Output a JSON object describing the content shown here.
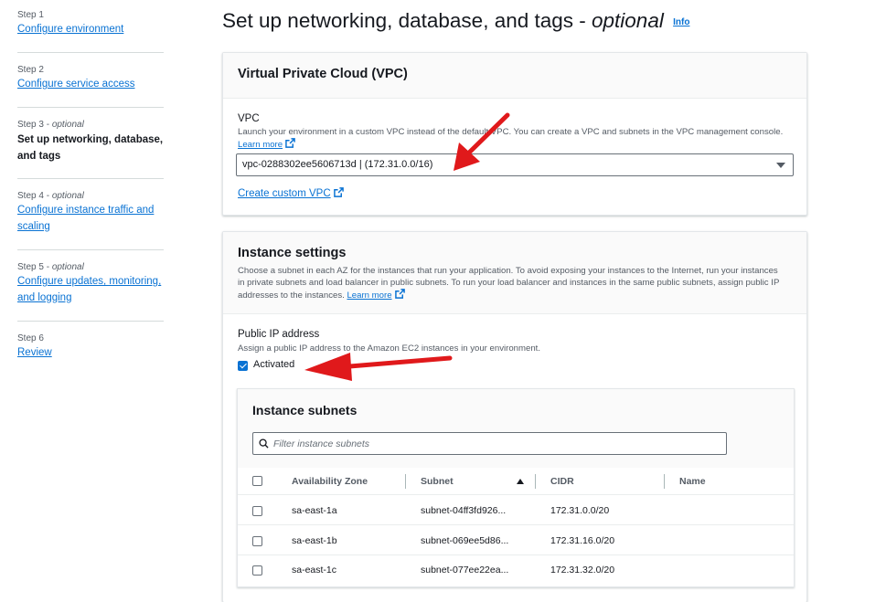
{
  "sidebar": {
    "steps": [
      {
        "caption": "Step 1",
        "optional": "",
        "label": "Configure environment",
        "lines": [
          "Configure environment"
        ],
        "current": false
      },
      {
        "caption": "Step 2",
        "optional": "",
        "label": "Configure service access",
        "lines": [
          "Configure service access"
        ],
        "current": false
      },
      {
        "caption": "Step 3",
        "optional": "optional",
        "label": "Set up networking, database, and tags",
        "lines": [
          "Set up networking, database,",
          "and tags"
        ],
        "current": true
      },
      {
        "caption": "Step 4",
        "optional": "optional",
        "label": "Configure instance traffic and scaling",
        "lines": [
          "Configure instance traffic and",
          "scaling"
        ],
        "current": false
      },
      {
        "caption": "Step 5",
        "optional": "optional",
        "label": "Configure updates, monitoring, and logging",
        "lines": [
          "Configure updates, monitoring,",
          "and logging"
        ],
        "current": false
      },
      {
        "caption": "Step 6",
        "optional": "",
        "label": "Review",
        "lines": [
          "Review"
        ],
        "current": false
      }
    ]
  },
  "header": {
    "title_main": "Set up networking, database, and tags - ",
    "title_optional": "optional",
    "info": "Info"
  },
  "vpc": {
    "title": "Virtual Private Cloud (VPC)",
    "field_label": "VPC",
    "description": "Launch your environment in a custom VPC instead of the default VPC. You can create a VPC and subnets in the VPC management console.",
    "learn_more": "Learn more",
    "selected_value": "vpc-0288302ee5606713d | (172.31.0.0/16)",
    "create_link": "Create custom VPC"
  },
  "instance_settings": {
    "title": "Instance settings",
    "description": "Choose a subnet in each AZ for the instances that run your application. To avoid exposing your instances to the Internet, run your instances in private subnets and load balancer in public subnets. To run your load balancer and instances in the same public subnets, assign public IP addresses to the instances.",
    "description_lines": [
      "Choose a subnet in each AZ for the instances that run your application. To avoid exposing your instances to the Internet, run your instances",
      "in private subnets and load balancer in public subnets. To run your load balancer and instances in the same public subnets, assign public IP",
      "addresses to the instances. "
    ],
    "learn_more": "Learn more",
    "public_ip_label": "Public IP address",
    "public_ip_description": "Assign a public IP address to the Amazon EC2 instances in your environment.",
    "activated_label": "Activated",
    "activated_checked": true
  },
  "subnets": {
    "title": "Instance subnets",
    "filter_placeholder": "Filter instance subnets",
    "columns": [
      "Availability Zone",
      "Subnet",
      "CIDR",
      "Name"
    ],
    "sort_column": "Subnet",
    "sort_direction": "ascending",
    "rows": [
      {
        "az": "sa-east-1a",
        "subnet": "subnet-04ff3fd926...",
        "cidr": "172.31.0.0/20",
        "name": ""
      },
      {
        "az": "sa-east-1b",
        "subnet": "subnet-069ee5d86...",
        "cidr": "172.31.16.0/20",
        "name": ""
      },
      {
        "az": "sa-east-1c",
        "subnet": "subnet-077ee22ea...",
        "cidr": "172.31.32.0/20",
        "name": ""
      }
    ]
  },
  "colors": {
    "link": "#0972d3",
    "annotation_arrow": "#e0191b",
    "text": "#16191f",
    "muted": "#545b64"
  },
  "icons": [
    "external-link-icon",
    "search-icon",
    "caret-down-icon",
    "sort-ascending-icon",
    "checkbox-icon"
  ]
}
